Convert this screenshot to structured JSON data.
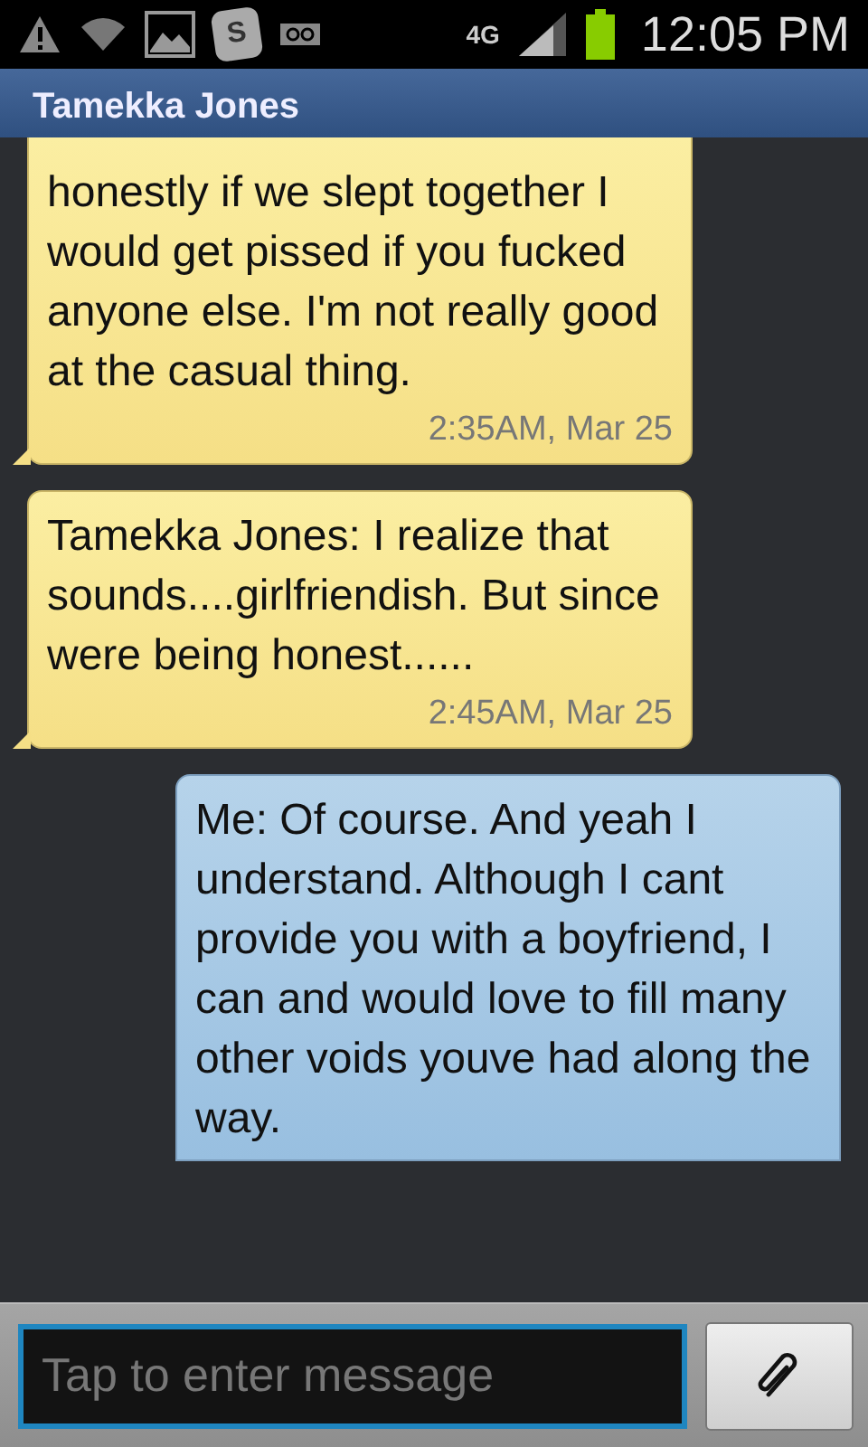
{
  "status_bar": {
    "app_icon_letter": "S",
    "network": "4G",
    "time": "12:05 PM"
  },
  "header": {
    "title": "Tamekka Jones"
  },
  "messages": [
    {
      "kind": "incoming",
      "text": "honestly if we slept together I would get pissed if you fucked anyone else. I'm not really good at the casual thing.",
      "time": "2:35AM, Mar 25"
    },
    {
      "kind": "incoming",
      "text": "Tamekka Jones: I realize that sounds....girlfriendish. But since were being honest......",
      "time": "2:45AM, Mar 25"
    },
    {
      "kind": "outgoing",
      "text": "Me: Of course. And yeah I understand. Although I cant provide you with a boyfriend, I can and would love to fill many other voids youve had along the way."
    }
  ],
  "composer": {
    "placeholder": "Tap to enter message"
  }
}
